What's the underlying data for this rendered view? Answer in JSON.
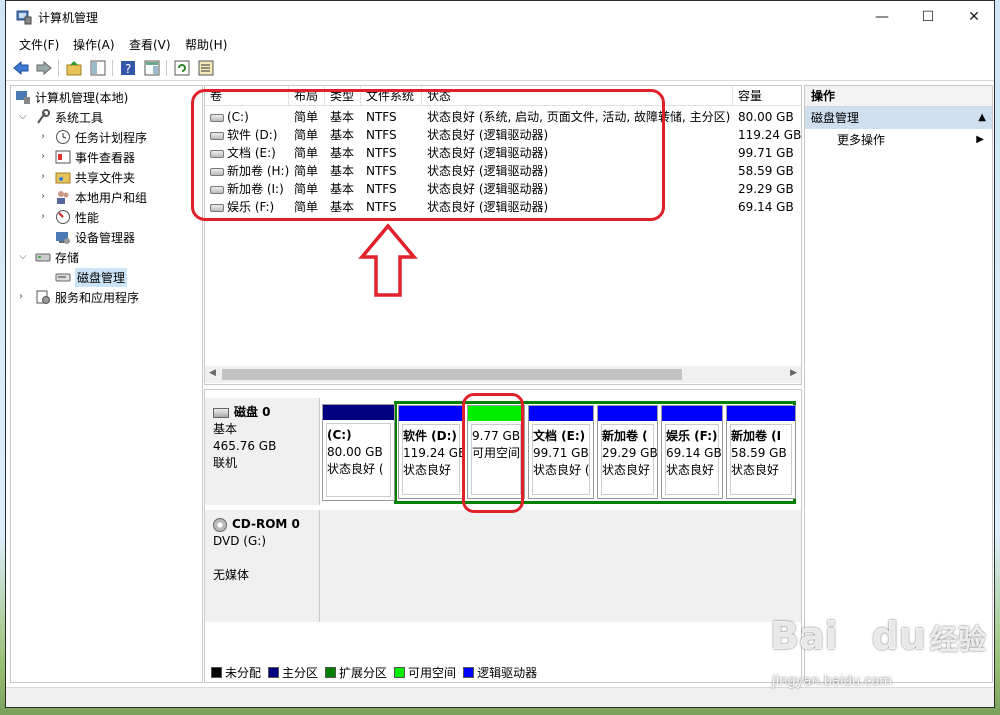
{
  "window": {
    "title": "计算机管理"
  },
  "menu": [
    "文件(F)",
    "操作(A)",
    "查看(V)",
    "帮助(H)"
  ],
  "tree": {
    "root": "计算机管理(本地)",
    "system_tools": "系统工具",
    "task_scheduler": "任务计划程序",
    "event_viewer": "事件查看器",
    "shared_folders": "共享文件夹",
    "local_users": "本地用户和组",
    "performance": "性能",
    "device_manager": "设备管理器",
    "storage": "存储",
    "disk_management": "磁盘管理",
    "services_apps": "服务和应用程序"
  },
  "volumes": {
    "headers": [
      "卷",
      "布局",
      "类型",
      "文件系统",
      "状态",
      "容量"
    ],
    "rows": [
      {
        "vol": "(C:)",
        "layout": "简单",
        "type": "基本",
        "fs": "NTFS",
        "status": "状态良好 (系统, 启动, 页面文件, 活动, 故障转储, 主分区)",
        "cap": "80.00 GB"
      },
      {
        "vol": "软件 (D:)",
        "layout": "简单",
        "type": "基本",
        "fs": "NTFS",
        "status": "状态良好 (逻辑驱动器)",
        "cap": "119.24 GB"
      },
      {
        "vol": "文档 (E:)",
        "layout": "简单",
        "type": "基本",
        "fs": "NTFS",
        "status": "状态良好 (逻辑驱动器)",
        "cap": "99.71 GB"
      },
      {
        "vol": "新加卷 (H:)",
        "layout": "简单",
        "type": "基本",
        "fs": "NTFS",
        "status": "状态良好 (逻辑驱动器)",
        "cap": "58.59 GB"
      },
      {
        "vol": "新加卷 (I:)",
        "layout": "简单",
        "type": "基本",
        "fs": "NTFS",
        "status": "状态良好 (逻辑驱动器)",
        "cap": "29.29 GB"
      },
      {
        "vol": "娱乐 (F:)",
        "layout": "简单",
        "type": "基本",
        "fs": "NTFS",
        "status": "状态良好 (逻辑驱动器)",
        "cap": "69.14 GB"
      }
    ]
  },
  "disk0": {
    "name": "磁盘 0",
    "type": "基本",
    "size": "465.76 GB",
    "state": "联机"
  },
  "partitions": [
    {
      "name": "(C:)",
      "size": "80.00 GB",
      "status": "状态良好 (",
      "color": "#000080"
    },
    {
      "name": "软件 (D:)",
      "size": "119.24 GB",
      "status": "状态良好",
      "color": "#0000ff"
    },
    {
      "name": "",
      "size": "9.77 GB",
      "status": "可用空间",
      "color": "#00ee00"
    },
    {
      "name": "文档 (E:)",
      "size": "99.71 GB",
      "status": "状态良好 (",
      "color": "#0000ff"
    },
    {
      "name": "新加卷 (",
      "size": "29.29 GB",
      "status": "状态良好",
      "color": "#0000ff"
    },
    {
      "name": "娱乐 (F:)",
      "size": "69.14 GB",
      "status": "状态良好",
      "color": "#0000ff"
    },
    {
      "name": "新加卷 (I",
      "size": "58.59 GB",
      "status": "状态良好",
      "color": "#0000ff"
    }
  ],
  "cdrom": {
    "name": "CD-ROM 0",
    "drive": "DVD (G:)",
    "media": "无媒体"
  },
  "legend": [
    {
      "label": "未分配",
      "color": "#000000"
    },
    {
      "label": "主分区",
      "color": "#000080"
    },
    {
      "label": "扩展分区",
      "color": "#008000"
    },
    {
      "label": "可用空间",
      "color": "#00ee00"
    },
    {
      "label": "逻辑驱动器",
      "color": "#0000ff"
    }
  ],
  "actions": {
    "header": "操作",
    "section": "磁盘管理",
    "more": "更多操作"
  },
  "watermark": {
    "brand": "Bai",
    "brand2": "du",
    "cn": "经验",
    "url": "jingyan.baidu.com"
  }
}
